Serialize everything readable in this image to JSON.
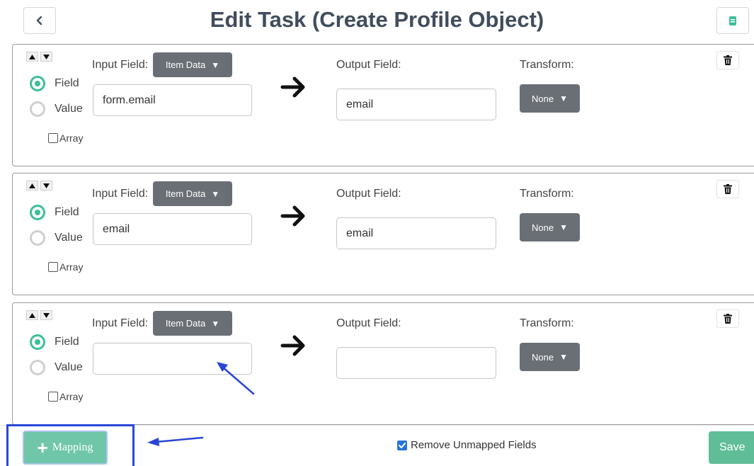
{
  "header": {
    "title": "Edit Task (Create Profile Object)",
    "back_icon": "chevron-left-icon",
    "notes_icon": "document-icon"
  },
  "labels": {
    "input_field": "Input Field:",
    "output_field": "Output Field:",
    "transform": "Transform:",
    "field": "Field",
    "value": "Value",
    "array": "Array"
  },
  "mappings": [
    {
      "source_type": "Item Data",
      "input_value": "form.email",
      "output_value": "email",
      "transform": "None",
      "mode": "Field",
      "array": false
    },
    {
      "source_type": "Item Data",
      "input_value": "email",
      "output_value": "email",
      "transform": "None",
      "mode": "Field",
      "array": false
    },
    {
      "source_type": "Item Data",
      "input_value": "",
      "output_value": "",
      "transform": "None",
      "mode": "Field",
      "array": false
    }
  ],
  "footer": {
    "add_mapping_label": "Mapping",
    "remove_unmapped_label": "Remove Unmapped Fields",
    "remove_unmapped_checked": true,
    "save_label": "Save"
  },
  "colors": {
    "accent_green": "#3dbf9a",
    "dropdown_gray": "#6a6f75",
    "title": "#414d5c",
    "annotation_blue": "#2946d8"
  }
}
